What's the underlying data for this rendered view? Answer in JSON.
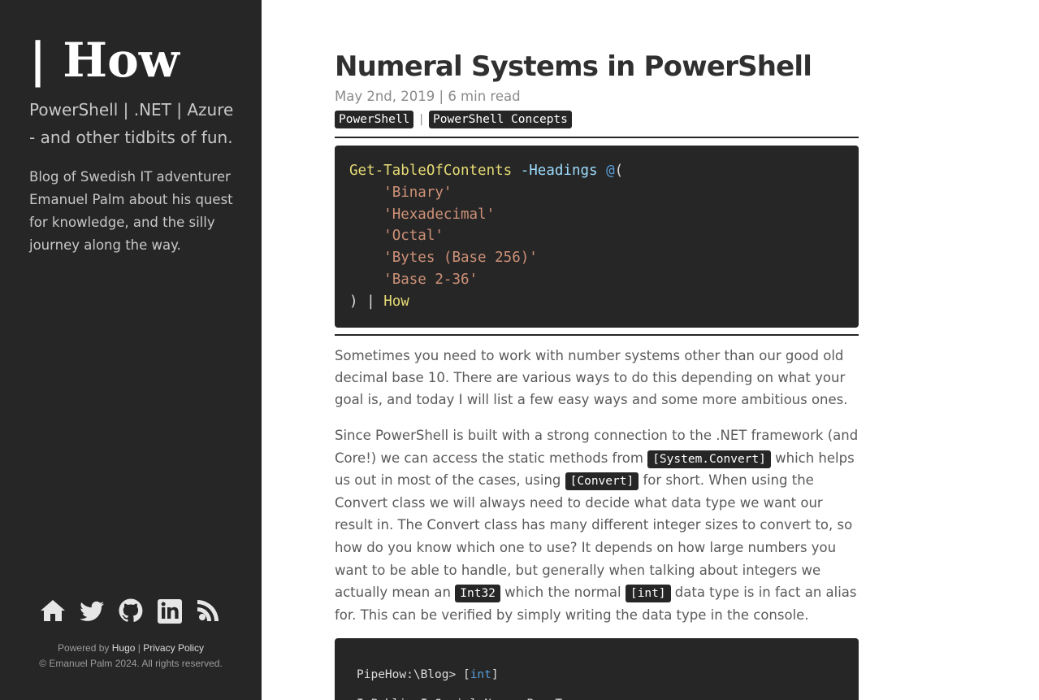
{
  "sidebar": {
    "site_title": "| How",
    "tagline": "PowerShell | .NET | Azure - and other tidbits of fun.",
    "about": "Blog of Swedish IT adventurer Emanuel Palm about his quest for knowledge, and the silly journey along the way.",
    "social_icons": [
      "home-icon",
      "twitter-icon",
      "github-icon",
      "linkedin-icon",
      "rss-icon"
    ],
    "footer": {
      "powered_by": "Powered by",
      "hugo_link": "Hugo",
      "separator": "|",
      "privacy_link": "Privacy Policy",
      "copyright": "© Emanuel Palm 2024. All rights reserved."
    },
    "colors": {
      "background": "#262626",
      "text": "#c8c8c8"
    }
  },
  "post": {
    "title": "Numeral Systems in PowerShell",
    "meta": "May 2nd, 2019 | 6 min read",
    "tags": [
      "PowerShell",
      "PowerShell Concepts"
    ],
    "tag_separator": "|",
    "toc_code": {
      "command": "Get-TableOfContents",
      "param": "-Headings",
      "array_start": "@",
      "open_paren": "(",
      "items": [
        "'Binary'",
        "'Hexadecimal'",
        "'Octal'",
        "'Bytes (Base 256)'",
        "'Base 2-36'"
      ],
      "close_paren": ")",
      "pipe": "|",
      "pipe_cmd": "How"
    },
    "paragraph1": "Sometimes you need to work with number systems other than our good old decimal base 10. There are various ways to do this depending on what your goal is, and today I will list a few easy ways and some more ambitious ones.",
    "paragraph2": {
      "t1": "Since PowerShell is built with a strong connection to the .NET framework (and Core!) we can access the static methods from ",
      "c1": "[System.Convert]",
      "t2": " which helps us out in most of the cases, using ",
      "c2": "[Convert]",
      "t3": " for short. When using the Convert class we will always need to decide what data type we want our result in. The Convert class has many different integer sizes to convert to, so how do you know which one to use? It depends on how large numbers you want to be able to handle, but generally when talking about integers we actually mean an ",
      "c3": "Int32",
      "t4": " which the normal ",
      "c4": "[int]",
      "t5": " data type is in fact an alias for. This can be verified by simply writing the data type in the console."
    },
    "console_code": {
      "prompt": "PipeHow:\\Blog> ",
      "bracket_open": "[",
      "type": "int",
      "bracket_close": "]",
      "output_header": "IsPublic IsSerial Name  BaseType"
    }
  }
}
